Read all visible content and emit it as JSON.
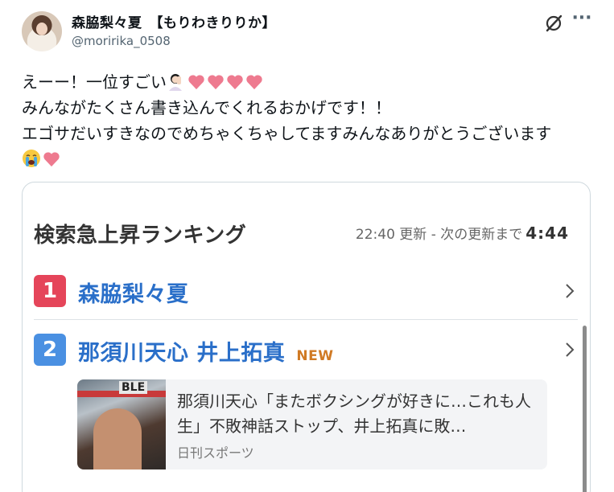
{
  "author": {
    "display_name": "森脇梨々夏　【もりわきりりか】",
    "handle": "@moririka_0508"
  },
  "post": {
    "lines": [
      "えーー！一位すごい",
      "みんながたくさん書き込んでくれるおかげです！！",
      "エゴサだいすきなのでめちゃくちゃしてますみんなありがとうございます"
    ],
    "emoji": [
      "person-facepalming",
      "pink-heart",
      "pink-heart",
      "pink-heart",
      "pink-heart",
      "loudly-crying-face",
      "pink-heart"
    ]
  },
  "card": {
    "title": "検索急上昇ランキング",
    "update_time": "22:40 更新 - 次の更新まで",
    "countdown": "4:44",
    "rankings": [
      {
        "rank": "1",
        "term": "森脇梨々夏",
        "badge": "",
        "color": "#e5455a"
      },
      {
        "rank": "2",
        "term": "那須川天心 井上拓真",
        "badge": "NEW",
        "color": "#4a90e2"
      }
    ],
    "news": {
      "sign_text": "BLE",
      "headline": "那須川天心「またボクシングが好きに…これも人生」不敗神話ストップ、井上拓真に敗…",
      "source": "日刊スポーツ"
    }
  },
  "colors": {
    "link_blue": "#2a6fc9",
    "new_orange": "#d07a24",
    "heart_pink": "#ee7a8f"
  }
}
